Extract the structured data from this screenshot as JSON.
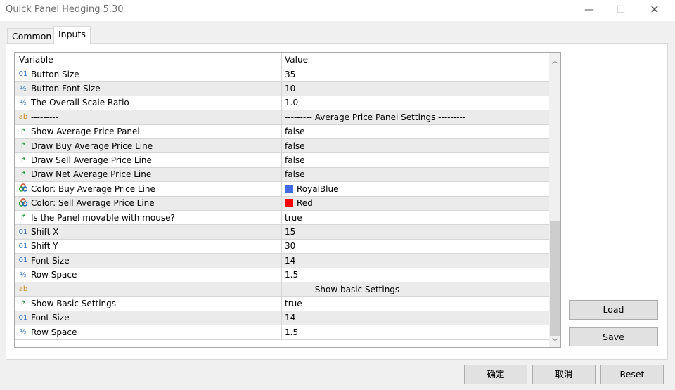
{
  "window": {
    "title": "Quick Panel Hedging 5.30",
    "controls": [
      "minimize",
      "maximize",
      "close"
    ]
  },
  "tabs": [
    {
      "label": "Common",
      "active": false
    },
    {
      "label": "Inputs",
      "active": true
    }
  ],
  "table": {
    "headers": [
      "Variable",
      "Value"
    ],
    "rows": [
      {
        "icon": "int",
        "variable": "Button Size",
        "value": "35"
      },
      {
        "icon": "double",
        "variable": "Button Font Size",
        "value": "10"
      },
      {
        "icon": "double",
        "variable": "The Overall Scale Ratio",
        "value": "1.0"
      },
      {
        "icon": "string",
        "variable": "---------",
        "value": "--------- Average Price Panel Settings ---------"
      },
      {
        "icon": "bool",
        "variable": "Show Average Price Panel",
        "value": "false"
      },
      {
        "icon": "bool",
        "variable": "Draw Buy Average Price Line",
        "value": "false"
      },
      {
        "icon": "bool",
        "variable": "Draw Sell Average Price Line",
        "value": "false"
      },
      {
        "icon": "bool",
        "variable": "Draw Net Average Price Line",
        "value": "false"
      },
      {
        "icon": "color",
        "variable": "Color: Buy Average Price Line",
        "value": "RoyalBlue",
        "swatch": "#4169e1"
      },
      {
        "icon": "color",
        "variable": "Color: Sell Average Price Line",
        "value": "Red",
        "swatch": "#ff0000"
      },
      {
        "icon": "bool",
        "variable": "Is the Panel movable with mouse?",
        "value": "true"
      },
      {
        "icon": "int",
        "variable": "Shift X",
        "value": "15"
      },
      {
        "icon": "int",
        "variable": "Shift Y",
        "value": "30"
      },
      {
        "icon": "int",
        "variable": "Font Size",
        "value": "14"
      },
      {
        "icon": "double",
        "variable": "Row Space",
        "value": "1.5"
      },
      {
        "icon": "string",
        "variable": "---------",
        "value": "--------- Show basic Settings ---------"
      },
      {
        "icon": "bool",
        "variable": "Show Basic Settings",
        "value": "true"
      },
      {
        "icon": "int",
        "variable": "Font Size",
        "value": "14"
      },
      {
        "icon": "double",
        "variable": "Row Space",
        "value": "1.5"
      }
    ]
  },
  "side_buttons": {
    "load": "Load",
    "save": "Save"
  },
  "footer": {
    "ok": "确定",
    "cancel": "取消",
    "reset": "Reset"
  }
}
